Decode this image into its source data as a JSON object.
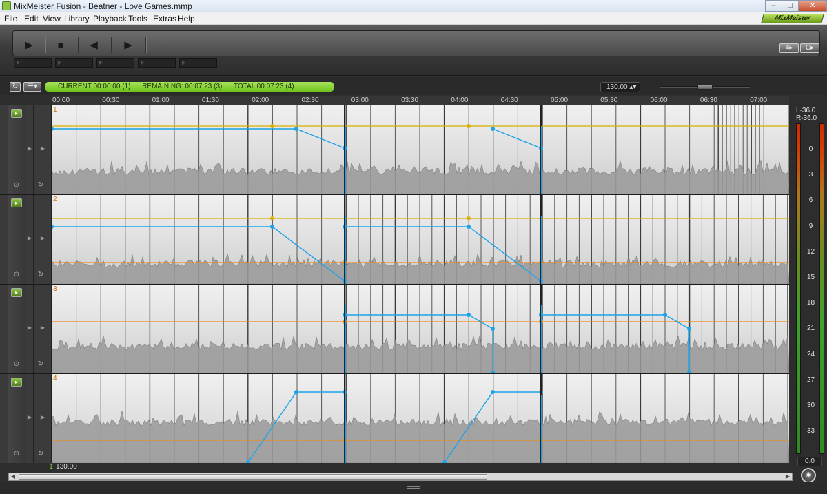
{
  "window": {
    "title": "MixMeister Fusion - Beatner - Love Games.mmp",
    "controls": [
      "minimize",
      "maximize",
      "close"
    ]
  },
  "menu": {
    "items": [
      "File",
      "Edit",
      "View",
      "Library",
      "Playback",
      "Tools",
      "Extras",
      "Help"
    ]
  },
  "brand": "MixMeister",
  "transport": {
    "buttons": [
      "play-icon",
      "stop-icon",
      "previous-icon",
      "next-icon",
      "mix-icon"
    ],
    "glyphs": [
      "▶",
      "■",
      "◀",
      "▶",
      "☁"
    ],
    "right_controls": [
      "≡▸",
      "C▸"
    ]
  },
  "status": {
    "current": "CURRENT 00:00:00 (1)",
    "remaining": "REMAINING: 00:07:23 (3)",
    "total": "TOTAL 00:07:23 (4)",
    "bpm_value": "130.00"
  },
  "timeline": {
    "ticks": [
      "00:00",
      "00:30",
      "01:00",
      "01:30",
      "02:00",
      "02:30",
      "03:00",
      "03:30",
      "04:00",
      "04:30",
      "05:00",
      "05:30",
      "06:00",
      "06:30",
      "07:00"
    ]
  },
  "tracks": [
    {
      "number": "1"
    },
    {
      "number": "2"
    },
    {
      "number": "3"
    },
    {
      "number": "4"
    }
  ],
  "meter": {
    "left_peak": "L-36.0",
    "right_peak": "R-36.0",
    "scale": [
      "0",
      "3",
      "6",
      "9",
      "12",
      "15",
      "18",
      "21",
      "24",
      "27",
      "30",
      "33"
    ],
    "value": "0.0"
  },
  "bottom": {
    "bpm_marker": "130.00"
  },
  "colors": {
    "accent_green": "#8dc63f",
    "envelope_blue": "#1aa3e8",
    "envelope_orange": "#f08a1e",
    "envelope_yellow": "#d7b000"
  }
}
